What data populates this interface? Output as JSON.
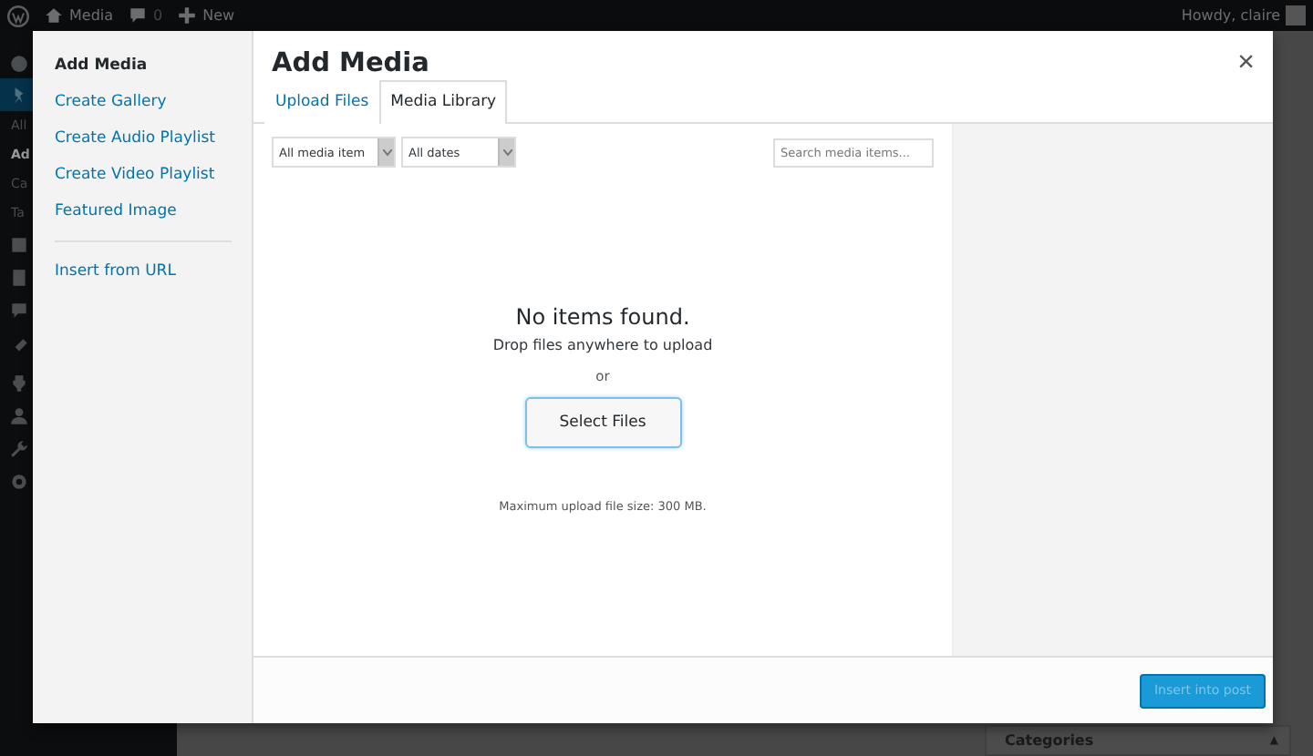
{
  "admin_bar": {
    "site": "Media",
    "comments": "0",
    "new": "New",
    "greeting": "Howdy, claire"
  },
  "admin_menu": {
    "items": [
      {
        "label": "All",
        "current": false
      },
      {
        "label": "Ad",
        "current": true
      },
      {
        "label": "Ca",
        "current": false
      },
      {
        "label": "Ta",
        "current": false
      }
    ]
  },
  "metabox": {
    "title": "Categories",
    "arrow": "▲"
  },
  "modal": {
    "title": "Add Media",
    "close": "×",
    "menu_groups": [
      [
        {
          "label": "Add Media",
          "selected": true
        },
        {
          "label": "Create Gallery",
          "selected": false
        },
        {
          "label": "Create Audio Playlist",
          "selected": false
        },
        {
          "label": "Create Video Playlist",
          "selected": false
        },
        {
          "label": "Featured Image",
          "selected": false
        }
      ],
      [
        {
          "label": "Insert from URL",
          "selected": false
        }
      ]
    ],
    "tabs": [
      {
        "label": "Upload Files",
        "selected": false
      },
      {
        "label": "Media Library",
        "selected": true
      }
    ],
    "filters": [
      {
        "value": "All media item"
      },
      {
        "value": "All dates"
      }
    ],
    "search": {
      "placeholder": "Search media items..."
    },
    "empty": {
      "title": "No items found.",
      "hint": "Drop files anywhere to upload",
      "or": "or",
      "button": "Select Files",
      "max_upload": "Maximum upload file size: 300 MB."
    },
    "primary_button": {
      "label": "Insert into post",
      "disabled": true
    }
  }
}
